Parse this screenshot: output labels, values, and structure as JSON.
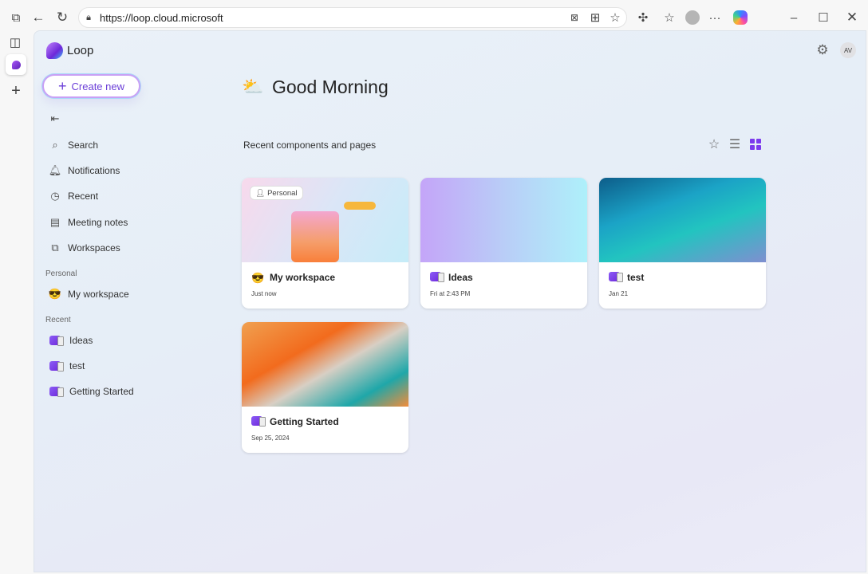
{
  "browser": {
    "url": "https://loop.cloud.microsoft"
  },
  "app": {
    "name": "Loop",
    "create_label": "Create new",
    "avatar": "AV",
    "greeting": "Good Morning",
    "recent_heading": "Recent components and pages"
  },
  "sidebar": {
    "nav": [
      {
        "label": "Search",
        "icon": "search-icon"
      },
      {
        "label": "Notifications",
        "icon": "bell-icon"
      },
      {
        "label": "Recent",
        "icon": "clock-icon"
      },
      {
        "label": "Meeting notes",
        "icon": "notes-icon"
      },
      {
        "label": "Workspaces",
        "icon": "workspaces-icon"
      }
    ],
    "personal_label": "Personal",
    "personal": [
      {
        "label": "My workspace"
      }
    ],
    "recent_label": "Recent",
    "recent": [
      {
        "label": "Ideas"
      },
      {
        "label": "test"
      },
      {
        "label": "Getting Started"
      }
    ]
  },
  "cards": [
    {
      "title": "My workspace",
      "date": "Just now",
      "badge": "Personal"
    },
    {
      "title": "Ideas",
      "date": "Fri at 2:43 PM"
    },
    {
      "title": "test",
      "date": "Jan 21"
    },
    {
      "title": "Getting Started",
      "date": "Sep 25, 2024"
    }
  ],
  "colors": {
    "accent": "#7c3aed"
  }
}
